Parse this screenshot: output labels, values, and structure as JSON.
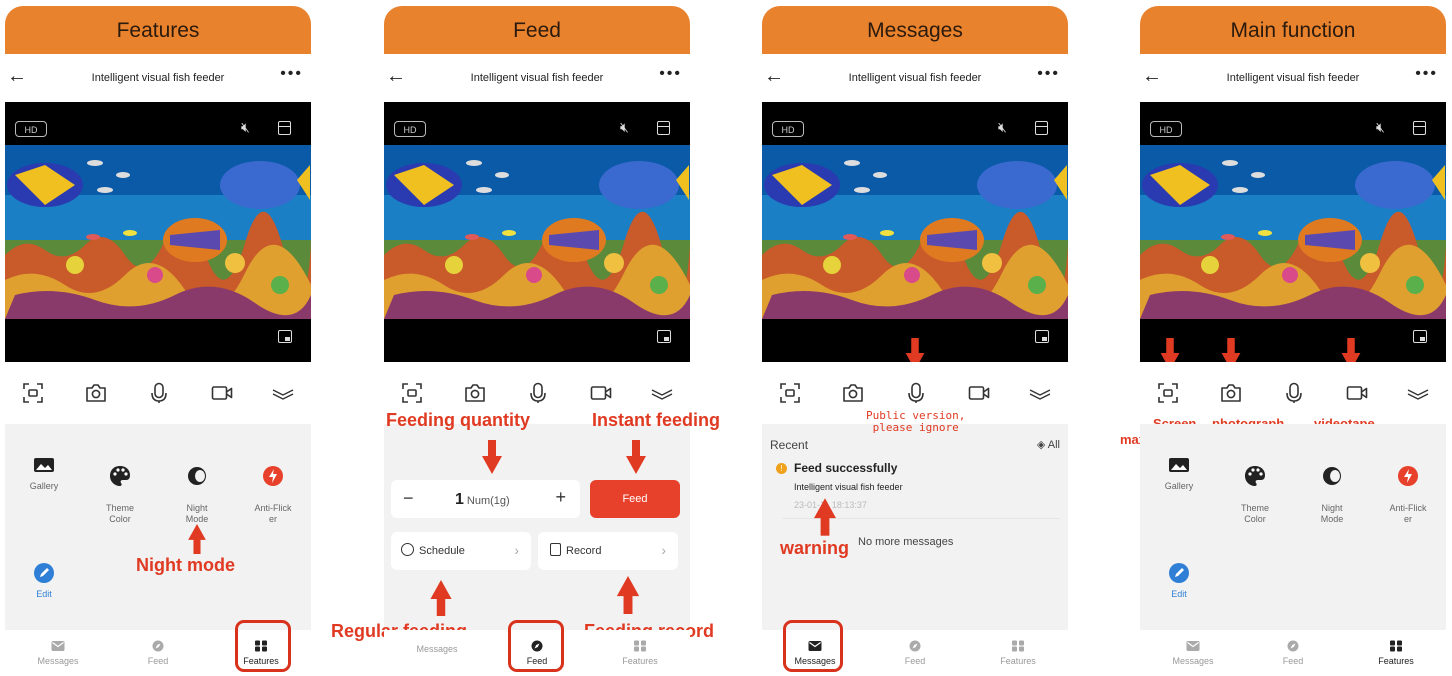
{
  "app": {
    "title": "Intelligent visual fish feeder",
    "back_icon": "arrow-left-icon",
    "more_label": "•••",
    "hd_label": "HD",
    "tabs": [
      "Messages",
      "Feed",
      "Features"
    ]
  },
  "panels": [
    {
      "header": "Features",
      "active_tab": "Features"
    },
    {
      "header": "Feed",
      "active_tab": "Feed"
    },
    {
      "header": "Messages",
      "active_tab": "Messages"
    },
    {
      "header": "Main function",
      "active_tab": "Features"
    }
  ],
  "features": {
    "gallery": "Gallery",
    "theme": "Theme\nColor",
    "night": "Night\nMode",
    "antiflicker": "Anti-Flick\ner",
    "edit": "Edit"
  },
  "feed": {
    "minus": "−",
    "plus": "+",
    "quantity_value": "1",
    "quantity_unit": "Num(1g)",
    "feed_button": "Feed",
    "schedule": "Schedule",
    "record": "Record"
  },
  "messages": {
    "recent": "Recent",
    "all": "All",
    "item_title": "Feed successfully",
    "item_sub": "Intelligent visual fish feeder",
    "item_time": "23-01-11 18:13:37",
    "no_more": "No more messages"
  },
  "annotations": {
    "night_mode": "Night mode",
    "feeding_quantity": "Feeding quantity",
    "instant_feeding": "Instant feeding",
    "regular_feeding": "Regular feeding",
    "feeding_record": "Feeding record",
    "public_version": "Public version,",
    "please_ignore": "please ignore",
    "warning": "warning",
    "screen": "Screen",
    "maximization": "maximization",
    "photograph": "photograph",
    "videotape": "videotape"
  },
  "colors": {
    "header": "#e8822c",
    "annotation": "#e03a22",
    "feed_button": "#e8412b",
    "warning_dot": "#f0a11c",
    "edit_blue": "#2f7fd6"
  }
}
